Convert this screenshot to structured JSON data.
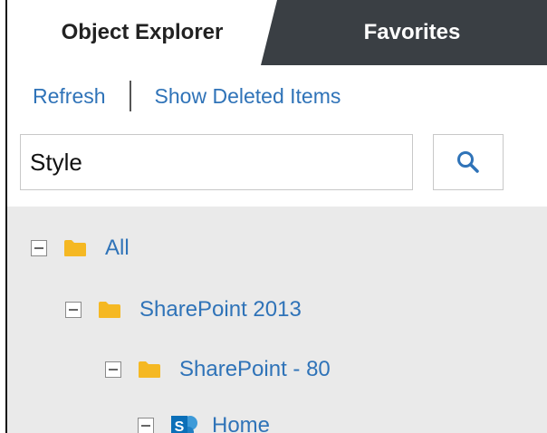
{
  "tabs": {
    "object_explorer": "Object Explorer",
    "favorites": "Favorites"
  },
  "actions": {
    "refresh": "Refresh",
    "show_deleted": "Show Deleted Items"
  },
  "search": {
    "value": "Style",
    "placeholder": ""
  },
  "tree": {
    "items": [
      {
        "label": "All",
        "icon": "folder-icon"
      },
      {
        "label": "SharePoint 2013",
        "icon": "folder-icon"
      },
      {
        "label": "SharePoint - 80",
        "icon": "folder-icon"
      },
      {
        "label": "Home",
        "icon": "sharepoint-site-icon"
      }
    ]
  },
  "colors": {
    "link": "#2f73b8",
    "active_tab_bg": "#ffffff",
    "inactive_tab_bg": "#3a3f44",
    "tree_bg": "#eaeaea",
    "folder": "#f5b823",
    "sharepoint": "#0b6fb8"
  }
}
